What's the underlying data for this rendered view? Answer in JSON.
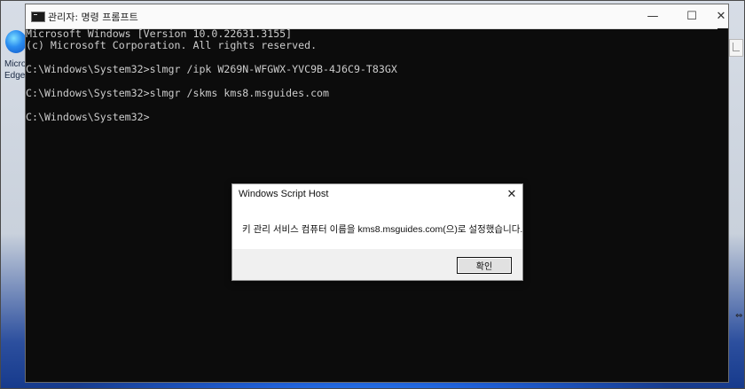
{
  "desktop": {
    "icon_label_line1": "Micro",
    "icon_label_line2": "Edge"
  },
  "console": {
    "title": "관리자: 명령 프롬프트",
    "controls": {
      "minimize": "—",
      "maximize": "☐",
      "close": "✕"
    },
    "lines": [
      "Microsoft Windows [Version 10.0.22631.3155]",
      "(c) Microsoft Corporation. All rights reserved.",
      "",
      "C:\\Windows\\System32>slmgr /ipk W269N-WFGWX-YVC9B-4J6C9-T83GX",
      "",
      "C:\\Windows\\System32>slmgr /skms kms8.msguides.com",
      "",
      "C:\\Windows\\System32>"
    ]
  },
  "dialog": {
    "title": "Windows Script Host",
    "close": "✕",
    "message": "키 관리 서비스 컴퓨터 이름을 kms8.msguides.com(으)로 설정했습니다.",
    "ok_label": "확인"
  }
}
